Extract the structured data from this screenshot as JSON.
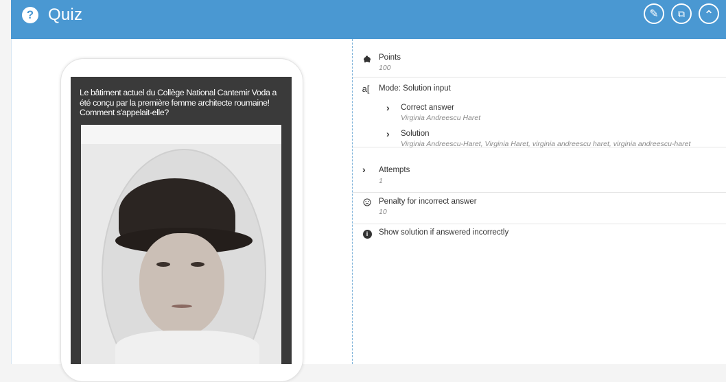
{
  "header": {
    "title": "Quiz",
    "badge_icon": "question-icon",
    "accent_color": "#4a98d2",
    "buttons": [
      {
        "name": "edit-button",
        "icon": "pencil-icon",
        "glyph": "✎"
      },
      {
        "name": "copy-button",
        "icon": "copy-icon",
        "glyph": "⧉"
      },
      {
        "name": "collapse-button",
        "icon": "chevron-up-icon",
        "glyph": "⌃"
      }
    ]
  },
  "preview": {
    "question": "Le bâtiment actuel du Collège National Cantemir Voda a été conçu par la première femme architecte roumaine! Comment s'appelait-elle?",
    "image_alt": "portrait"
  },
  "settings": {
    "points": {
      "label": "Points",
      "value": "100"
    },
    "mode": {
      "label": "Mode: Solution input"
    },
    "correct_answer": {
      "label": "Correct answer",
      "value": "Virginia Andreescu Haret"
    },
    "solution": {
      "label": "Solution",
      "value": "Virginia Andreescu-Haret, Virginia Haret, virginia andreescu haret, virginia andreescu-haret"
    },
    "attempts": {
      "label": "Attempts",
      "value": "1"
    },
    "penalty": {
      "label": "Penalty for incorrect answer",
      "value": "10"
    },
    "show_solution": {
      "label": "Show solution if answered incorrectly"
    }
  }
}
